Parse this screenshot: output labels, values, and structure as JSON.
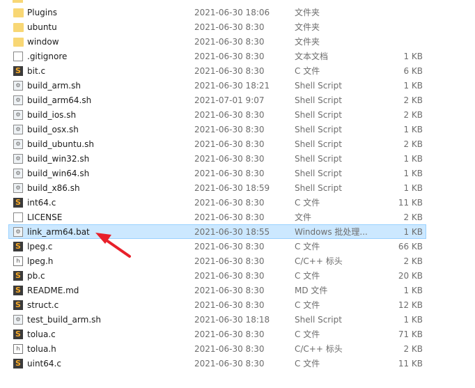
{
  "files": [
    {
      "name": "Plugins",
      "date": "2021-06-30 18:06",
      "type": "文件夹",
      "size": "",
      "icon": "folder-icon"
    },
    {
      "name": "ubuntu",
      "date": "2021-06-30 8:30",
      "type": "文件夹",
      "size": "",
      "icon": "folder-icon"
    },
    {
      "name": "window",
      "date": "2021-06-30 8:30",
      "type": "文件夹",
      "size": "",
      "icon": "folder-icon"
    },
    {
      "name": ".gitignore",
      "date": "2021-06-30 8:30",
      "type": "文本文档",
      "size": "1 KB",
      "icon": "text-file-icon"
    },
    {
      "name": "bit.c",
      "date": "2021-06-30 8:30",
      "type": "C 文件",
      "size": "6 KB",
      "icon": "sublime-file-icon"
    },
    {
      "name": "build_arm.sh",
      "date": "2021-06-30 18:21",
      "type": "Shell Script",
      "size": "1 KB",
      "icon": "shell-script-icon"
    },
    {
      "name": "build_arm64.sh",
      "date": "2021-07-01 9:07",
      "type": "Shell Script",
      "size": "2 KB",
      "icon": "shell-script-icon"
    },
    {
      "name": "build_ios.sh",
      "date": "2021-06-30 8:30",
      "type": "Shell Script",
      "size": "2 KB",
      "icon": "shell-script-icon"
    },
    {
      "name": "build_osx.sh",
      "date": "2021-06-30 8:30",
      "type": "Shell Script",
      "size": "1 KB",
      "icon": "shell-script-icon"
    },
    {
      "name": "build_ubuntu.sh",
      "date": "2021-06-30 8:30",
      "type": "Shell Script",
      "size": "2 KB",
      "icon": "shell-script-icon"
    },
    {
      "name": "build_win32.sh",
      "date": "2021-06-30 8:30",
      "type": "Shell Script",
      "size": "1 KB",
      "icon": "shell-script-icon"
    },
    {
      "name": "build_win64.sh",
      "date": "2021-06-30 8:30",
      "type": "Shell Script",
      "size": "1 KB",
      "icon": "shell-script-icon"
    },
    {
      "name": "build_x86.sh",
      "date": "2021-06-30 18:59",
      "type": "Shell Script",
      "size": "1 KB",
      "icon": "shell-script-icon"
    },
    {
      "name": "int64.c",
      "date": "2021-06-30 8:30",
      "type": "C 文件",
      "size": "11 KB",
      "icon": "sublime-file-icon"
    },
    {
      "name": "LICENSE",
      "date": "2021-06-30 8:30",
      "type": "文件",
      "size": "2 KB",
      "icon": "blank-file-icon"
    },
    {
      "name": "link_arm64.bat",
      "date": "2021-06-30 18:55",
      "type": "Windows 批处理...",
      "size": "1 KB",
      "icon": "batch-file-icon",
      "selected": true
    },
    {
      "name": "lpeg.c",
      "date": "2021-06-30 8:30",
      "type": "C 文件",
      "size": "66 KB",
      "icon": "sublime-file-icon"
    },
    {
      "name": "lpeg.h",
      "date": "2021-06-30 8:30",
      "type": "C/C++ 标头",
      "size": "2 KB",
      "icon": "header-file-icon"
    },
    {
      "name": "pb.c",
      "date": "2021-06-30 8:30",
      "type": "C 文件",
      "size": "20 KB",
      "icon": "sublime-file-icon"
    },
    {
      "name": "README.md",
      "date": "2021-06-30 8:30",
      "type": "MD 文件",
      "size": "1 KB",
      "icon": "sublime-file-icon"
    },
    {
      "name": "struct.c",
      "date": "2021-06-30 8:30",
      "type": "C 文件",
      "size": "12 KB",
      "icon": "sublime-file-icon"
    },
    {
      "name": "test_build_arm.sh",
      "date": "2021-06-30 18:18",
      "type": "Shell Script",
      "size": "1 KB",
      "icon": "shell-script-icon"
    },
    {
      "name": "tolua.c",
      "date": "2021-06-30 8:30",
      "type": "C 文件",
      "size": "71 KB",
      "icon": "sublime-file-icon"
    },
    {
      "name": "tolua.h",
      "date": "2021-06-30 8:30",
      "type": "C/C++ 标头",
      "size": "2 KB",
      "icon": "header-file-icon"
    },
    {
      "name": "uint64.c",
      "date": "2021-06-30 8:30",
      "type": "C 文件",
      "size": "11 KB",
      "icon": "sublime-file-icon"
    }
  ],
  "colors": {
    "selection": "#cce8ff",
    "arrow": "#e8202a"
  }
}
